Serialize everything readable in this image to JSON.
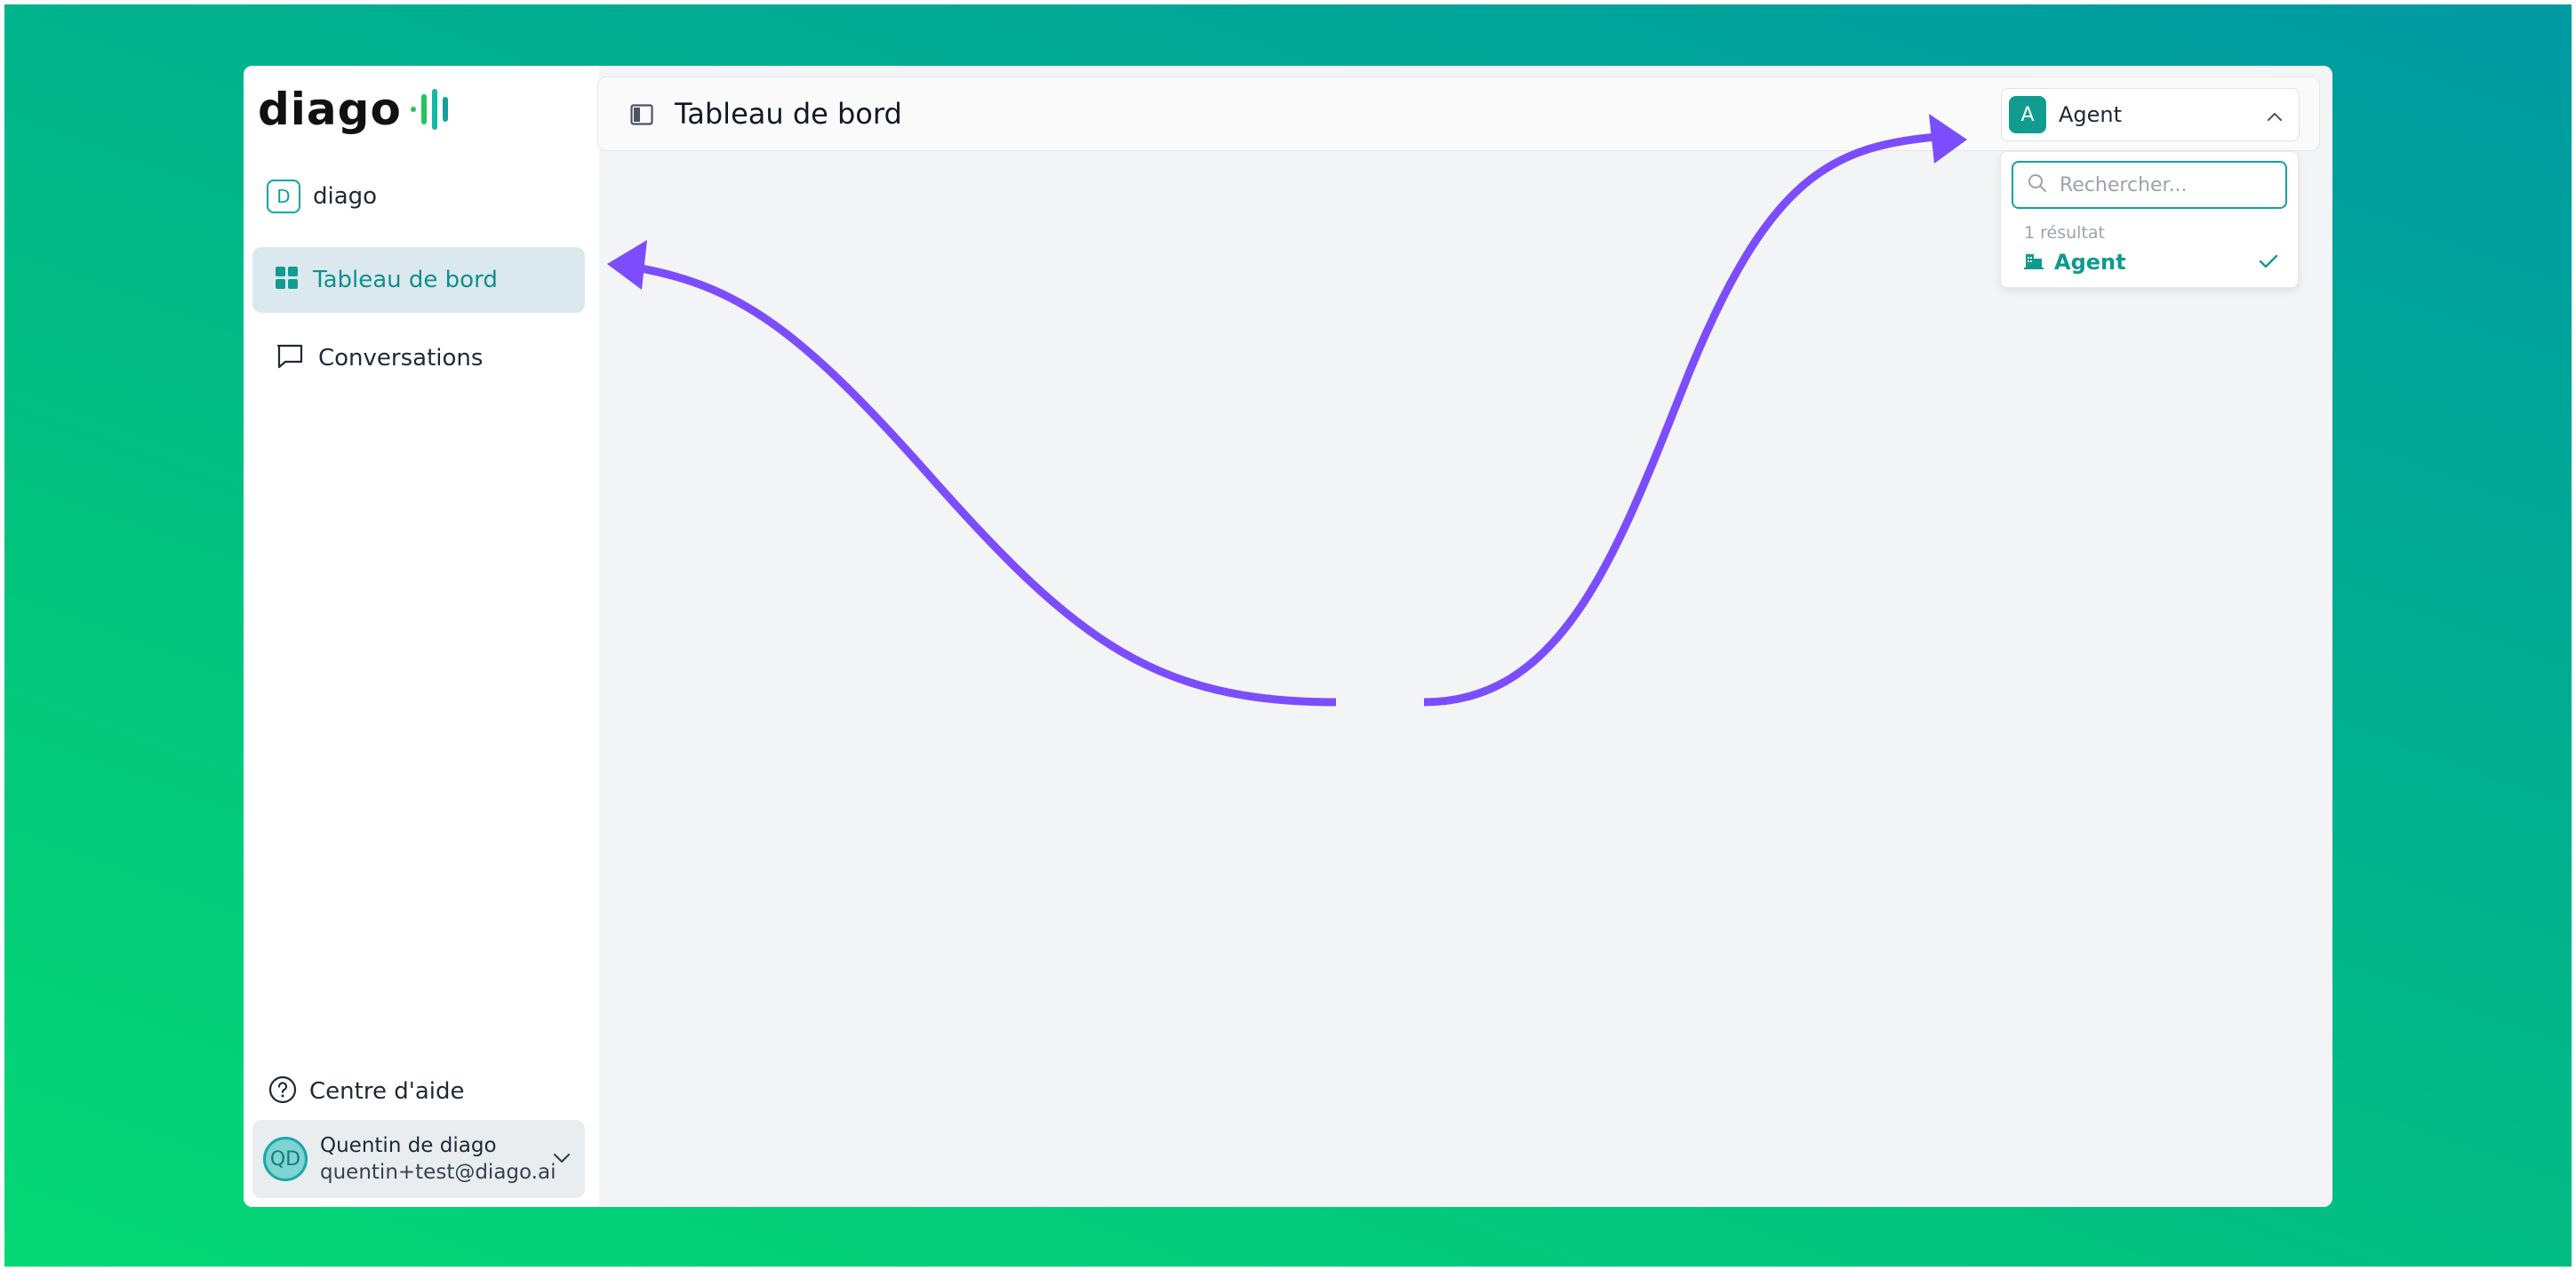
{
  "brand": {
    "logo_text": "diago",
    "accent": "#0ea5a4",
    "arrow_color": "#7c4dff"
  },
  "sidebar": {
    "organization": {
      "initial": "D",
      "name": "diago"
    },
    "items": [
      {
        "label": "Tableau de bord",
        "icon": "dashboard-icon",
        "active": true
      },
      {
        "label": "Conversations",
        "icon": "chat-icon",
        "active": false
      }
    ],
    "help": {
      "label": "Centre d'aide",
      "icon": "help-circle-icon"
    },
    "user": {
      "initials": "QD",
      "name": "Quentin de diago",
      "email": "quentin+test@diago.ai"
    }
  },
  "header": {
    "title": "Tableau de bord",
    "agent_select": {
      "badge": "A",
      "label": "Agent"
    }
  },
  "dropdown": {
    "search_placeholder": "Rechercher...",
    "result_count": "1 résultat",
    "options": [
      {
        "label": "Agent",
        "selected": true,
        "icon": "building-icon"
      }
    ]
  }
}
